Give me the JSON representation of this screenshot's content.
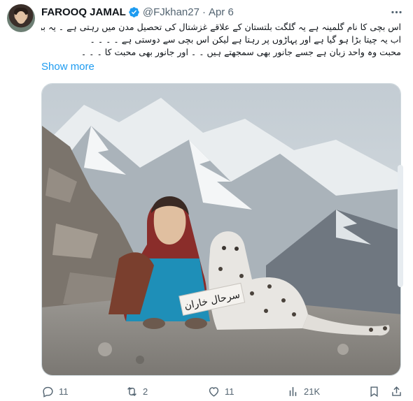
{
  "author": {
    "name": "FAROOQ JAMAL",
    "handle": "@FJkhan27",
    "separator": "·",
    "date": "Apr 6",
    "verified": true
  },
  "tweet": {
    "lines": [
      "اس بچی کا نام گلمینہ ہے یہ گلگت بلتستان کے علاقے غزشتال کی تحصیل مدن میں رہتی ہے ۔ یہ برفانی چیتا اس بچی نے بلی کا بچہ سمجھ کر پالا تھا",
      "اب یہ چیتا بڑا ہو گیا ہے اور پہاڑوں پر رہتا ہے لیکن اس بچی سے دوستی ہے ۔ ۔ ۔ ۔",
      "محبت وہ واحد زبان ہے جسے جانور بھی سمجھتے ہیں ۔ ۔ اور جانور بھی محبت کا ۔ ۔ ۔"
    ],
    "show_more": "Show more"
  },
  "media": {
    "caption_overlay": "سرحال خاران",
    "sky_color": "#c9d2d8",
    "ground_color": "#8c8a86"
  },
  "actions": {
    "replies": "11",
    "reposts": "2",
    "likes": "11",
    "views": "21K"
  },
  "colors": {
    "accent": "#1d9bf0",
    "muted": "#536471",
    "text": "#0f1419"
  },
  "icons": [
    "verified-badge-icon",
    "more-icon",
    "reply-icon",
    "repost-icon",
    "like-icon",
    "views-icon",
    "bookmark-icon",
    "share-icon"
  ]
}
